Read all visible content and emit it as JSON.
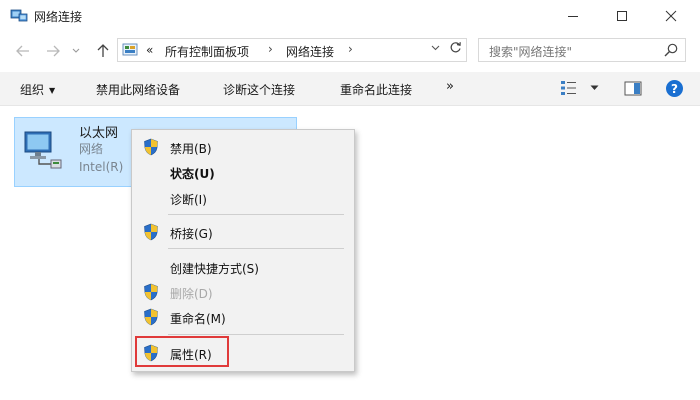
{
  "window": {
    "title": "网络连接",
    "icon": "network-connections-icon"
  },
  "address_bar": {
    "back_icon": "back-arrow-icon",
    "forward_icon": "forward-arrow-icon",
    "up_icon": "up-arrow-icon",
    "overflow": "«",
    "breadcrumbs": [
      "所有控制面板项",
      "网络连接"
    ],
    "separator": "›",
    "search_placeholder": "搜索\"网络连接\""
  },
  "toolbar": {
    "organize": "组织",
    "disable_device": "禁用此网络设备",
    "diagnose": "诊断这个连接",
    "rename": "重命名此连接",
    "more": "»"
  },
  "network_item": {
    "name": "以太网",
    "type": "网络",
    "device": "Intel(R)"
  },
  "context_menu": {
    "items": [
      {
        "label": "禁用(B)",
        "icon": "uac-shield-icon",
        "bold": false,
        "disabled": false
      },
      {
        "label": "状态(U)",
        "icon": "",
        "bold": true,
        "disabled": false
      },
      {
        "label": "诊断(I)",
        "icon": "",
        "bold": false,
        "disabled": false
      },
      {
        "label": "桥接(G)",
        "icon": "uac-shield-icon",
        "bold": false,
        "disabled": false
      },
      {
        "label": "创建快捷方式(S)",
        "icon": "",
        "bold": false,
        "disabled": false
      },
      {
        "label": "删除(D)",
        "icon": "uac-shield-icon",
        "bold": false,
        "disabled": true
      },
      {
        "label": "重命名(M)",
        "icon": "uac-shield-icon",
        "bold": false,
        "disabled": false
      },
      {
        "label": "属性(R)",
        "icon": "uac-shield-icon",
        "bold": false,
        "disabled": false
      }
    ],
    "highlighted_item": "属性(R)",
    "highlight_color": "#e03a3a"
  },
  "colors": {
    "selection_bg": "#cce8ff",
    "selection_border": "#99d1ff",
    "toolbar_bg": "#f3f3f3",
    "menu_bg": "#f2f2f2",
    "help_blue": "#1a6fd1"
  }
}
